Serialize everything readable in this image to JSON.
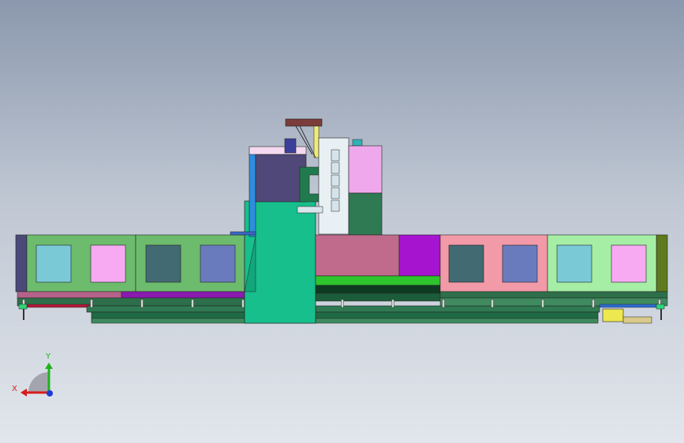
{
  "view": {
    "background_top": "#8b98ad",
    "background_bottom": "#e2e6ec"
  },
  "triad": {
    "x_label": "X",
    "y_label": "Y",
    "x_color": "#d81b1b",
    "y_color": "#1db31d",
    "z_color": "#1a3bd8"
  },
  "model": {
    "colors": {
      "base_bed": "#2f7a52",
      "column": "#16bf8c",
      "bay_green": "#6dbb6d",
      "bay_pink": "#f29aa8",
      "bay_light_green": "#a6eea6",
      "window_cyan": "#7ac9d6",
      "window_magenta": "#f7aaf2",
      "window_slate": "#416a73",
      "window_blue": "#6a7bbd",
      "panel_rose": "#c06a8c",
      "panel_purple": "#a614d0",
      "rail_green": "#2ec42e",
      "head_lavender": "#f0a8ec",
      "head_slate": "#4f4878",
      "bracket": "#217a4e",
      "yellow_block": "#ede84d",
      "brown_bar": "#7a3d39"
    }
  }
}
